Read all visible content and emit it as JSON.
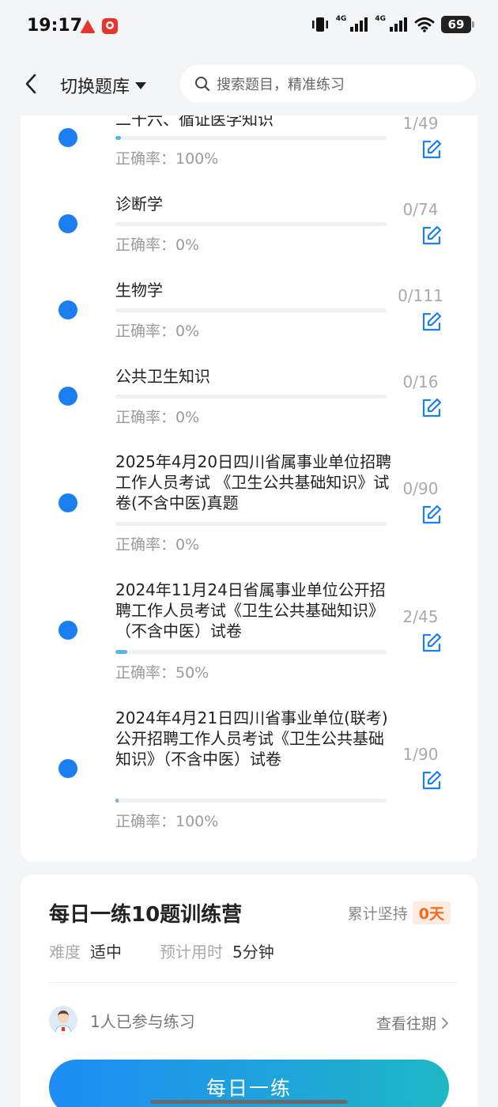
{
  "status_bar": {
    "time": "19:17",
    "network_1": "4G",
    "network_2": "4G",
    "battery": "69",
    "icons": [
      "app-badge-red-icon",
      "app-badge-red-square-icon",
      "vibrate-icon",
      "signal-icon",
      "wifi-icon",
      "battery-icon"
    ]
  },
  "nav": {
    "back_icon": "chevron-left-icon",
    "switch_label": "切换题库",
    "search_placeholder": "搜索题目，精准练习"
  },
  "chapters": [
    {
      "title": "二十六、循证医学知识",
      "count": "1/49",
      "accuracy": "正确率：100%",
      "progress": 0.02
    },
    {
      "title": "诊断学",
      "count": "0/74",
      "accuracy": "正确率：0%",
      "progress": 0
    },
    {
      "title": "生物学",
      "count": "0/111",
      "accuracy": "正确率：0%",
      "progress": 0
    },
    {
      "title": "公共卫生知识",
      "count": "0/16",
      "accuracy": "正确率：0%",
      "progress": 0
    },
    {
      "title": "2025年4月20日四川省属事业单位招聘工作人员考试 《卫生公共基础知识》试卷(不含中医)真题",
      "count": "0/90",
      "accuracy": "正确率：0%",
      "progress": 0
    },
    {
      "title": "2024年11月24日省属事业单位公开招聘工作人员考试《卫生公共基础知识》（不含中医）试卷",
      "count": "2/45",
      "accuracy": "正确率：50%",
      "progress": 0.044
    },
    {
      "title": "2024年4月21日四川省事业单位(联考)公开招聘工作人员考试《卫生公共基础知识》（不含中医）试卷",
      "count": "1/90",
      "accuracy": "正确率：100%",
      "progress": 0.011
    }
  ],
  "camp": {
    "title": "每日一练10题训练营",
    "streak_label": "累计坚持",
    "streak_value": "0天",
    "difficulty_label": "难度",
    "difficulty_value": "适中",
    "time_label": "预计用时",
    "time_value": "5分钟",
    "participants": "1人已参与练习",
    "history_link": "查看往期",
    "button": "每日一练"
  },
  "colors": {
    "accent": "#1a7ff0",
    "progress": "#5ab4e6",
    "streak": "#f06a1f",
    "button_start": "#1e8cf5",
    "button_end": "#1fb6c6"
  }
}
